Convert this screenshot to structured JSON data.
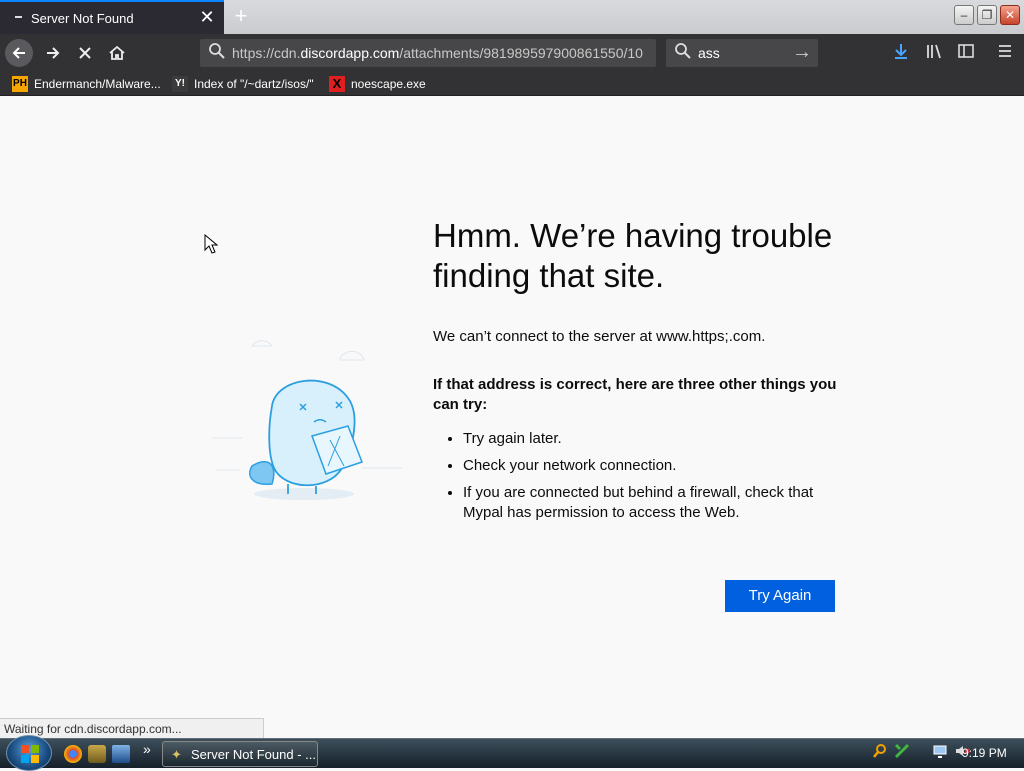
{
  "tab": {
    "title": "Server Not Found",
    "close": "✕",
    "newtab": "+"
  },
  "window": {
    "minimize": "–",
    "restore": "❐",
    "close": "✕"
  },
  "nav": {
    "url_prefix": "https://cdn.",
    "url_host": "discordapp.com",
    "url_rest": "/attachments/981989597900861550/10",
    "search_value": "ass",
    "search_go": "→"
  },
  "bookmarks": [
    {
      "icon": "PH",
      "label": "Endermanch/Malware..."
    },
    {
      "icon": "Y!",
      "label": "Index of \"/~dartz/isos/\""
    },
    {
      "icon": "X",
      "label": "noescape.exe"
    }
  ],
  "error": {
    "title": "Hmm. We’re having trouble finding that site.",
    "lead": "We can’t connect to the server at www.https;.com.",
    "subhead": "If that address is correct, here are three other things you can try:",
    "tips": [
      "Try again later.",
      "Check your network connection.",
      "If you are connected but behind a firewall, check that Mypal has permission to access the Web."
    ],
    "button": "Try Again"
  },
  "status": {
    "text": "Waiting for cdn.discordapp.com..."
  },
  "taskbar": {
    "task_label": "Server Not Found - ...",
    "overflow": "»",
    "clock": "9:19 PM"
  },
  "colors": {
    "accent": "#0060df",
    "tab_indicator": "#0a84ff",
    "toolbar": "#323234"
  }
}
